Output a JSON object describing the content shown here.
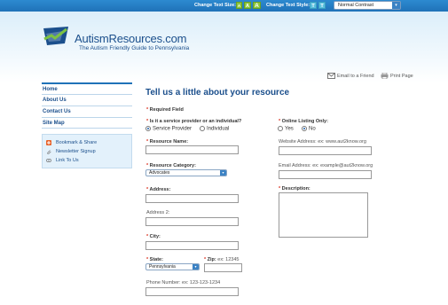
{
  "topbar": {
    "text_size_label": "Change Text Size:",
    "text_size_buttons": [
      "A",
      "A",
      "A"
    ],
    "text_style_label": "Change Text Style:",
    "text_style_buttons": [
      "T",
      "T"
    ],
    "contrast_value": "Normal Contrast"
  },
  "header": {
    "title": "AutismResources.com",
    "subtitle": "The Autism Friendly Guide to Pennsylvania"
  },
  "utility": {
    "email_friend": "Email to a Friend",
    "print_page": "Print Page"
  },
  "nav": {
    "items": [
      "Home",
      "About Us",
      "Contact Us",
      "Site Map"
    ]
  },
  "links_box": {
    "items": [
      "Bookmark & Share",
      "Newsletter Signup",
      "Link To Us"
    ]
  },
  "form": {
    "title": "Tell us a little about your resource",
    "required_note": "Required Field",
    "provider_type_label": "Is it a service provider or an individual?",
    "provider_options": [
      "Service Provider",
      "Individual"
    ],
    "online_listing_label": "Online Listing Only:",
    "online_options": [
      "Yes",
      "No"
    ],
    "resource_name_label": "Resource Name:",
    "website_label": "Website Address: ex: www.aut2know.org",
    "resource_category_label": "Resource Category:",
    "resource_category_value": "Advocates",
    "email_label": "Email Address: ex: example@aut2know.org",
    "address_label": "Address:",
    "description_label": "Description:",
    "address2_label": "Address 2:",
    "city_label": "City:",
    "state_label": "State:",
    "state_value": "Pennsylvania",
    "zip_label": "Zip:",
    "zip_hint": "ex: 12345",
    "phone_label": "Phone Number: ex: 123-123-1234",
    "star": "*"
  },
  "colors": {
    "brand_blue": "#1b4f8c",
    "topbar_blue": "#1f72b8",
    "text_size_green": "#8cc63f",
    "required_red": "#d9301f"
  }
}
